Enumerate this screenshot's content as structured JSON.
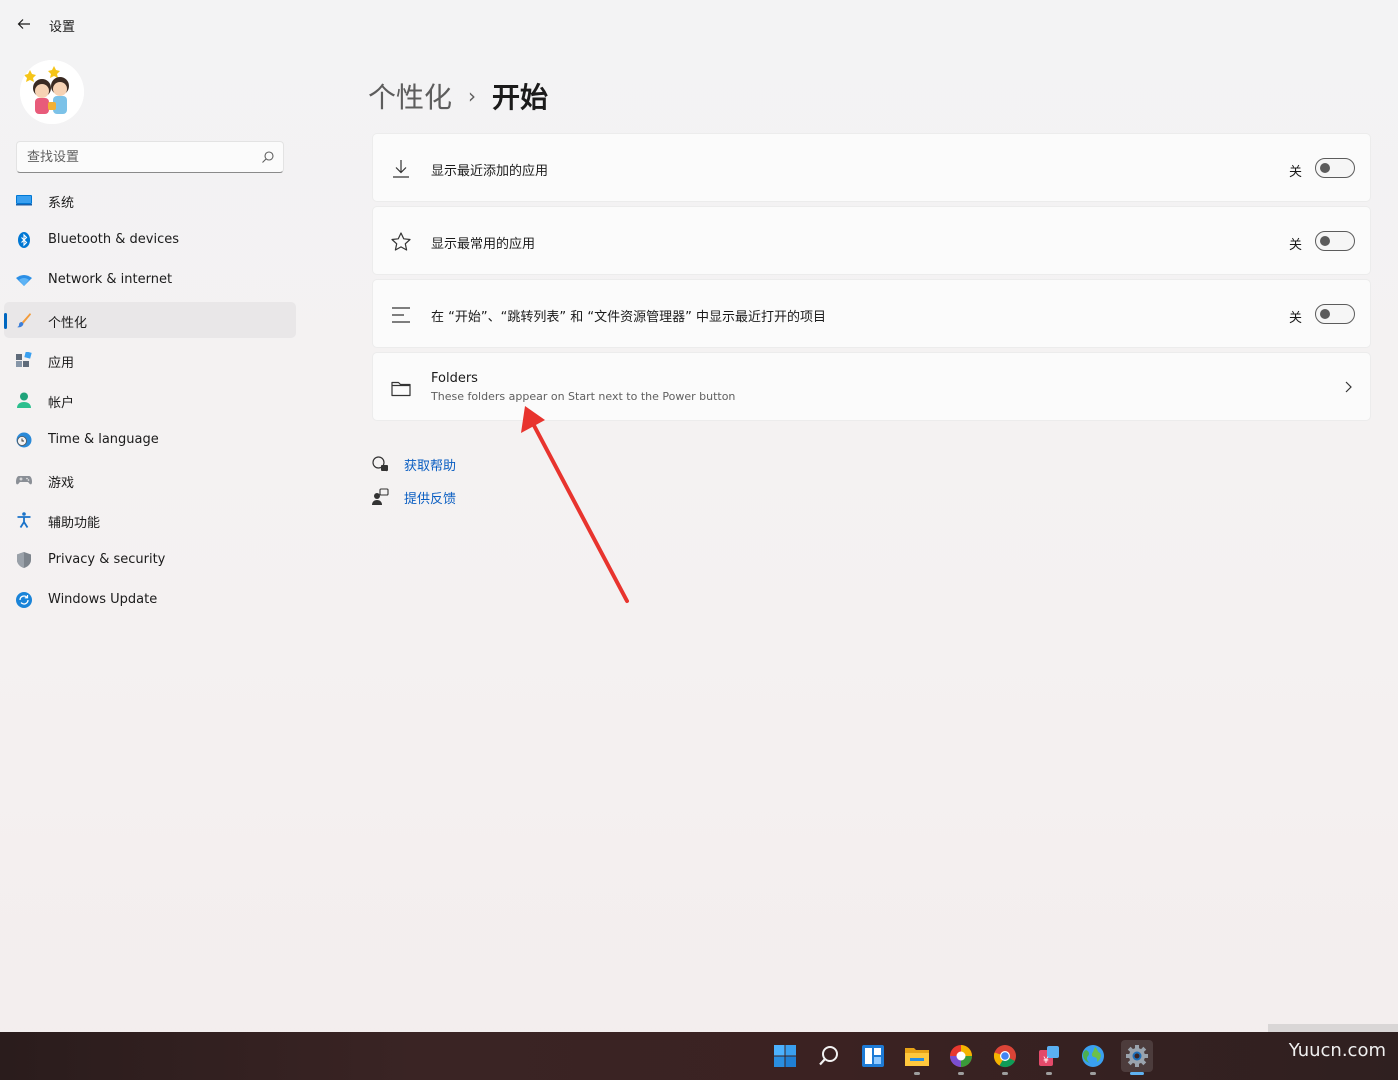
{
  "window": {
    "title": "设置"
  },
  "sidebar": {
    "search_placeholder": "查找设置",
    "items": [
      {
        "label": "系统",
        "icon": "system-icon"
      },
      {
        "label": "Bluetooth & devices",
        "icon": "bluetooth-icon"
      },
      {
        "label": "Network & internet",
        "icon": "wifi-icon"
      },
      {
        "label": "个性化",
        "icon": "brush-icon",
        "active": true
      },
      {
        "label": "应用",
        "icon": "apps-icon"
      },
      {
        "label": "帐户",
        "icon": "account-icon"
      },
      {
        "label": "Time & language",
        "icon": "globe-clock-icon"
      },
      {
        "label": "游戏",
        "icon": "gamepad-icon"
      },
      {
        "label": "辅助功能",
        "icon": "accessibility-icon"
      },
      {
        "label": "Privacy & security",
        "icon": "shield-icon"
      },
      {
        "label": "Windows Update",
        "icon": "update-icon"
      }
    ]
  },
  "header": {
    "parent": "个性化",
    "separator": "›",
    "current": "开始"
  },
  "settings": [
    {
      "label": "显示最近添加的应用",
      "state": "关",
      "icon": "download-icon"
    },
    {
      "label": "显示最常用的应用",
      "state": "关",
      "icon": "star-icon"
    },
    {
      "label": "在 “开始”、“跳转列表” 和 “文件资源管理器” 中显示最近打开的项目",
      "state": "关",
      "icon": "list-icon"
    }
  ],
  "folders": {
    "title": "Folders",
    "subtitle": "These folders appear on Start next to the Power button",
    "icon": "folder-icon"
  },
  "help": {
    "get_help": "获取帮助",
    "feedback": "提供反馈"
  },
  "taskbar": {
    "icons": [
      "windows-start-icon",
      "search-icon",
      "widgets-icon",
      "file-explorer-icon",
      "colorful-app-icon",
      "chrome-icon",
      "red-app-icon",
      "globe-app-icon",
      "settings-gear-icon"
    ]
  },
  "watermark": "Yuucn.com",
  "colors": {
    "accent": "#0067c0",
    "link": "#0a5ec2",
    "annotation": "#e8342e"
  }
}
